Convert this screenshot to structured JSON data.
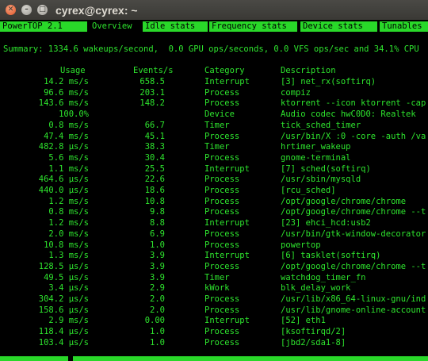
{
  "window": {
    "title": "cyrex@cyrex: ~"
  },
  "tabs": [
    {
      "label": "PowerTOP 2.1",
      "active": false
    },
    {
      "label": "Overview",
      "active": true
    },
    {
      "label": "Idle stats",
      "active": false
    },
    {
      "label": "Frequency stats",
      "active": false
    },
    {
      "label": "Device stats",
      "active": false
    },
    {
      "label": "Tunables",
      "active": false
    }
  ],
  "summary": "Summary: 1334.6 wakeups/second,  0.0 GPU ops/seconds, 0.0 VFS ops/sec and 34.1% CPU",
  "headers": {
    "usage": "Usage",
    "events": "Events/s",
    "category": "Category",
    "description": "Description"
  },
  "rows": [
    {
      "usage": "14.2 ms/s",
      "events": "658.5",
      "category": "Interrupt",
      "description": "[3] net_rx(softirq)"
    },
    {
      "usage": "96.6 ms/s",
      "events": "203.1",
      "category": "Process",
      "description": "compiz"
    },
    {
      "usage": "143.6 ms/s",
      "events": "148.2",
      "category": "Process",
      "description": "ktorrent --icon ktorrent -cap"
    },
    {
      "usage": "100.0%",
      "events": "",
      "category": "Device",
      "description": "Audio codec hwC0D0: Realtek"
    },
    {
      "usage": "0.8 ms/s",
      "events": "66.7",
      "category": "Timer",
      "description": "tick_sched_timer"
    },
    {
      "usage": "47.4 ms/s",
      "events": "45.1",
      "category": "Process",
      "description": "/usr/bin/X :0 -core -auth /va"
    },
    {
      "usage": "482.8 µs/s",
      "events": "38.3",
      "category": "Timer",
      "description": "hrtimer_wakeup"
    },
    {
      "usage": "5.6 ms/s",
      "events": "30.4",
      "category": "Process",
      "description": "gnome-terminal"
    },
    {
      "usage": "1.1 ms/s",
      "events": "25.5",
      "category": "Interrupt",
      "description": "[7] sched(softirq)"
    },
    {
      "usage": "464.6 µs/s",
      "events": "22.6",
      "category": "Process",
      "description": "/usr/sbin/mysqld"
    },
    {
      "usage": "440.0 µs/s",
      "events": "18.6",
      "category": "Process",
      "description": "[rcu_sched]"
    },
    {
      "usage": "1.2 ms/s",
      "events": "10.8",
      "category": "Process",
      "description": "/opt/google/chrome/chrome"
    },
    {
      "usage": "0.8 ms/s",
      "events": "9.8",
      "category": "Process",
      "description": "/opt/google/chrome/chrome --t"
    },
    {
      "usage": "1.2 ms/s",
      "events": "8.8",
      "category": "Interrupt",
      "description": "[23] ehci_hcd:usb2"
    },
    {
      "usage": "2.0 ms/s",
      "events": "6.9",
      "category": "Process",
      "description": "/usr/bin/gtk-window-decorator"
    },
    {
      "usage": "10.8 ms/s",
      "events": "1.0",
      "category": "Process",
      "description": "powertop"
    },
    {
      "usage": "1.3 ms/s",
      "events": "3.9",
      "category": "Interrupt",
      "description": "[6] tasklet(softirq)"
    },
    {
      "usage": "128.5 µs/s",
      "events": "3.9",
      "category": "Process",
      "description": "/opt/google/chrome/chrome --t"
    },
    {
      "usage": "49.5 µs/s",
      "events": "3.9",
      "category": "Timer",
      "description": "watchdog_timer_fn"
    },
    {
      "usage": "3.4 µs/s",
      "events": "2.9",
      "category": "kWork",
      "description": "blk_delay_work"
    },
    {
      "usage": "304.2 µs/s",
      "events": "2.0",
      "category": "Process",
      "description": "/usr/lib/x86_64-linux-gnu/ind"
    },
    {
      "usage": "158.6 µs/s",
      "events": "2.0",
      "category": "Process",
      "description": "/usr/lib/gnome-online-account"
    },
    {
      "usage": "2.9 ms/s",
      "events": "0.00",
      "category": "Interrupt",
      "description": "[52] eth1"
    },
    {
      "usage": "118.4 µs/s",
      "events": "1.0",
      "category": "Process",
      "description": "[ksoftirqd/2]"
    },
    {
      "usage": "103.4 µs/s",
      "events": "1.0",
      "category": "Process",
      "description": "[jbd2/sda1-8]"
    }
  ]
}
